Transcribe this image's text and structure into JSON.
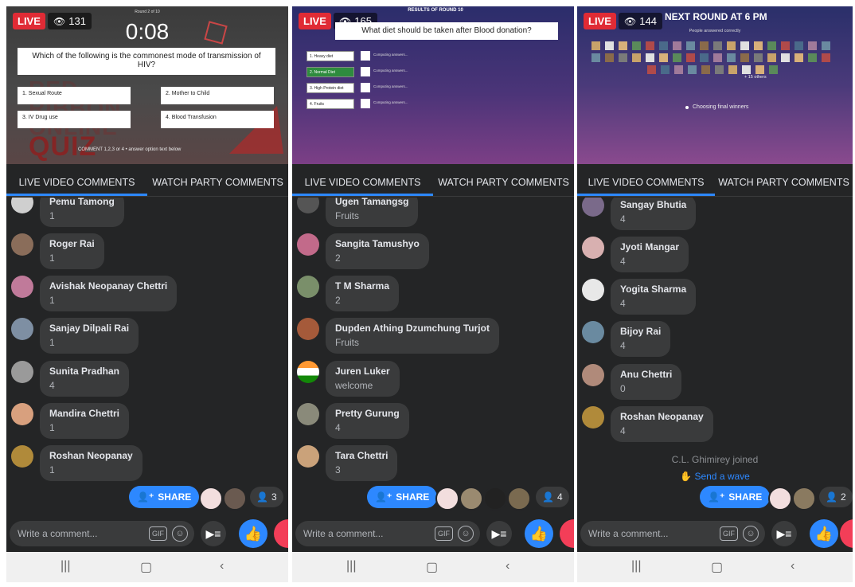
{
  "panels": [
    {
      "live": "LIVE",
      "viewers": "131",
      "tabs": [
        "LIVE VIDEO COMMENTS",
        "WATCH PARTY COMMENTS"
      ],
      "video": {
        "round": "Round 2 of 10",
        "timer": "0:08",
        "question": "Which of the following is the commonest mode of transmission of HIV?",
        "options": [
          "1. Sexual Route",
          "2. Mother to Child",
          "3. IV Drug use",
          "4. Blood Transfusion"
        ],
        "instruction": "COMMENT 1,2,3 or 4 • answer option text below",
        "bg_text": [
          "RED",
          "RIBBON",
          "ONLINE",
          "QUIZ"
        ]
      },
      "comments": [
        {
          "name": "Pemu Tamong",
          "text": "1"
        },
        {
          "name": "Roger Rai",
          "text": "1"
        },
        {
          "name": "Avishak Neopanay Chettri",
          "text": "1"
        },
        {
          "name": "Sanjay Dilpali Rai",
          "text": "1"
        },
        {
          "name": "Sunita Pradhan",
          "text": "4"
        },
        {
          "name": "Mandira Chettri",
          "text": "1"
        },
        {
          "name": "Roshan Neopanay",
          "text": "1"
        }
      ],
      "share": "SHARE",
      "watchers": "3",
      "composer": "Write a comment...",
      "gif": "GIF"
    },
    {
      "live": "LIVE",
      "viewers": "165",
      "tabs": [
        "LIVE VIDEO COMMENTS",
        "WATCH PARTY COMMENTS"
      ],
      "video": {
        "round": "RESULTS OF ROUND 10",
        "question": "What diet should be taken after Blood donation?",
        "options": [
          "1. Heavy diet",
          "2. Normal Diet",
          "3. High Protein diet",
          "4. Fruits"
        ],
        "computing": "Computing answers..."
      },
      "comments": [
        {
          "name": "Ugen Tamangsg",
          "text": "Fruits"
        },
        {
          "name": "Sangita Tamushyo",
          "text": "2"
        },
        {
          "name": "T M Sharma",
          "text": "2"
        },
        {
          "name": "Dupden Athing Dzumchung Turjot",
          "text": "Fruits"
        },
        {
          "name": "Juren Luker",
          "text": "welcome"
        },
        {
          "name": "Pretty Gurung",
          "text": "4"
        },
        {
          "name": "Tara Chettri",
          "text": "3"
        }
      ],
      "share": "SHARE",
      "watchers": "4",
      "composer": "Write a comment...",
      "gif": "GIF"
    },
    {
      "live": "LIVE",
      "viewers": "144",
      "tabs": [
        "LIVE VIDEO COMMENTS",
        "WATCH PARTY COMMENTS"
      ],
      "video": {
        "headline": "NEXT ROUND AT 6 PM",
        "subline": "People answered correctly",
        "others": "+ 15 others",
        "status": "Choosing final winners"
      },
      "comments": [
        {
          "name": "Sangay Bhutia",
          "text": "4"
        },
        {
          "name": "Jyoti Mangar",
          "text": "4"
        },
        {
          "name": "Yogita Sharma",
          "text": "4"
        },
        {
          "name": "Bijoy Rai",
          "text": "4"
        },
        {
          "name": "Anu Chettri",
          "text": "0"
        },
        {
          "name": "Roshan Neopanay",
          "text": "4"
        }
      ],
      "joined": "C.L. Ghimirey joined",
      "wave": "Send a wave",
      "share": "SHARE",
      "watchers": "2",
      "composer": "Write a comment...",
      "gif": "GIF"
    }
  ],
  "colors": {
    "live_red": "#e02b35",
    "facebook_blue": "#2d88ff",
    "panel_dark": "#242526",
    "bubble": "#3a3b3c",
    "correct_green": "#2e8b3e"
  },
  "icons": [
    "eye-icon",
    "share-icon",
    "person-icon",
    "gif-icon",
    "smiley-icon",
    "questions-icon",
    "like-icon",
    "love-icon",
    "nav-recents-icon",
    "nav-home-icon",
    "nav-back-icon",
    "wave-icon"
  ]
}
